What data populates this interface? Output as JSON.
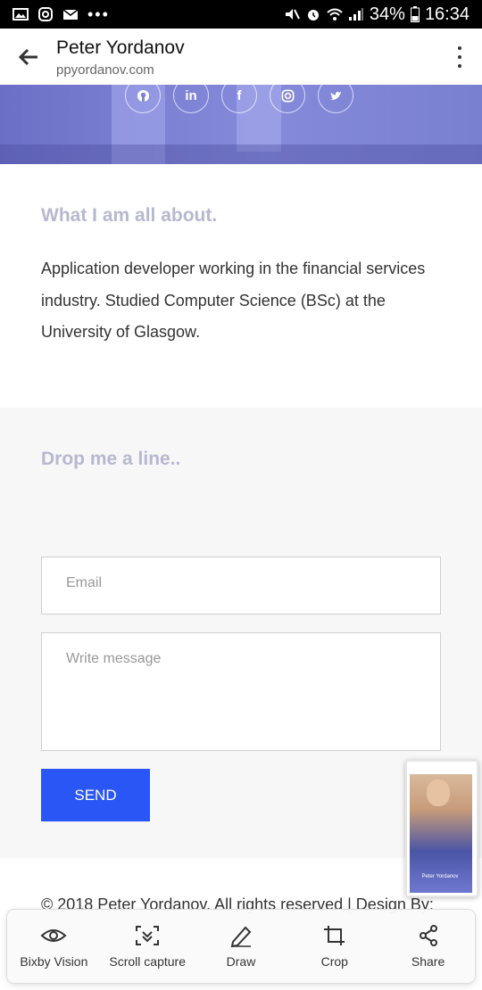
{
  "status_bar": {
    "battery": "34%",
    "time": "16:34"
  },
  "app_bar": {
    "title": "Peter Yordanov",
    "url": "ppyordanov.com"
  },
  "social_icons": [
    "github-icon",
    "linkedin-icon",
    "facebook-icon",
    "instagram-icon",
    "twitter-icon"
  ],
  "about": {
    "heading": "What I am all about.",
    "text": "Application developer working in the financial services industry. Studied Computer Science (BSc) at the University of Glasgow."
  },
  "contact": {
    "heading": "Drop me a line..",
    "email_placeholder": "Email",
    "message_placeholder": "Write message",
    "send_label": "SEND"
  },
  "footer": {
    "copyright": "© 2018 Peter Yordanov. All rights reserved | Design By:"
  },
  "screenshot_toolbar": {
    "items": [
      {
        "label": "Bixby Vision",
        "icon": "eye-icon"
      },
      {
        "label": "Scroll capture",
        "icon": "scroll-capture-icon"
      },
      {
        "label": "Draw",
        "icon": "pencil-icon"
      },
      {
        "label": "Crop",
        "icon": "crop-icon"
      },
      {
        "label": "Share",
        "icon": "share-icon"
      }
    ]
  },
  "thumbnail": {
    "name": "Peter Yordanov"
  },
  "colors": {
    "accent": "#2a56f5",
    "heading": "#b7b8cf",
    "hero_tint": "#7d82d4"
  }
}
